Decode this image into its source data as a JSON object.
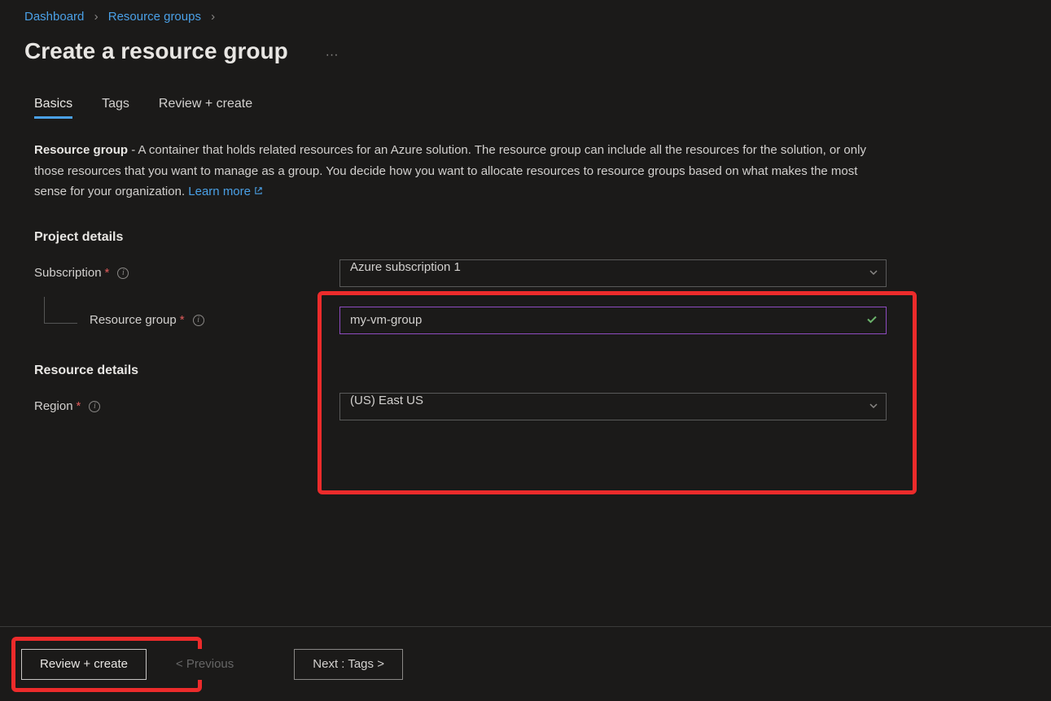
{
  "breadcrumb": {
    "dashboard": "Dashboard",
    "resource_groups": "Resource groups"
  },
  "page_title": "Create a resource group",
  "tabs": {
    "basics": "Basics",
    "tags": "Tags",
    "review": "Review + create"
  },
  "description": {
    "bold_lead": "Resource group",
    "body": " - A container that holds related resources for an Azure solution. The resource group can include all the resources for the solution, or only those resources that you want to manage as a group. You decide how you want to allocate resources to resource groups based on what makes the most sense for your organization. ",
    "learn_more": "Learn more"
  },
  "sections": {
    "project_details": "Project details",
    "resource_details": "Resource details"
  },
  "fields": {
    "subscription_label": "Subscription",
    "subscription_value": "Azure subscription 1",
    "resource_group_label": "Resource group",
    "resource_group_value": "my-vm-group",
    "region_label": "Region",
    "region_value": "(US) East US"
  },
  "footer": {
    "review_create": "Review + create",
    "previous": "< Previous",
    "next": "Next : Tags >"
  }
}
